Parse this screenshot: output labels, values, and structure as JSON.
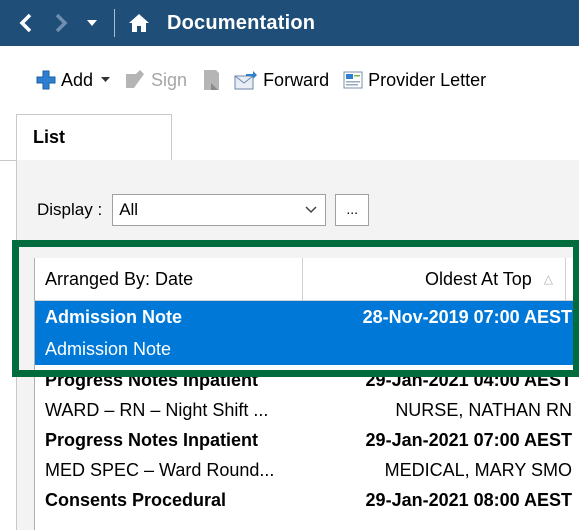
{
  "titlebar": {
    "title": "Documentation"
  },
  "toolbar": {
    "add_label": "Add",
    "sign_label": "Sign",
    "forward_label": "Forward",
    "provider_letter_label": "Provider Letter"
  },
  "tabs": {
    "list_label": "List"
  },
  "display": {
    "label": "Display :",
    "value": "All",
    "more_label": "..."
  },
  "list": {
    "header_arranged": "Arranged By: Date",
    "header_order": "Oldest At Top",
    "notes": [
      {
        "title": "Admission Note",
        "datetime": "28-Nov-2019 07:00 AEST",
        "subtitle": "Admission Note",
        "author": ""
      },
      {
        "title": "Progress Notes Inpatient",
        "datetime": "29-Jan-2021 04:00 AEST",
        "subtitle": "WARD – RN – Night Shift ...",
        "author": "NURSE, NATHAN RN"
      },
      {
        "title": "Progress Notes Inpatient",
        "datetime": "29-Jan-2021 07:00 AEST",
        "subtitle": "MED SPEC – Ward Round...",
        "author": "MEDICAL, MARY SMO"
      },
      {
        "title": "Consents Procedural",
        "datetime": "29-Jan-2021 08:00 AEST",
        "subtitle": "",
        "author": ""
      }
    ]
  },
  "colors": {
    "titlebar": "#1f4e79",
    "selection": "#0078d7",
    "highlight_box": "#006b3c"
  },
  "icons": [
    "back-arrow-icon",
    "forward-arrow-icon",
    "dropdown-caret-icon",
    "home-icon",
    "plus-icon",
    "sign-icon",
    "document-icon",
    "forward-envelope-icon",
    "letter-icon",
    "chevron-down-icon",
    "sort-arrow-icon"
  ]
}
